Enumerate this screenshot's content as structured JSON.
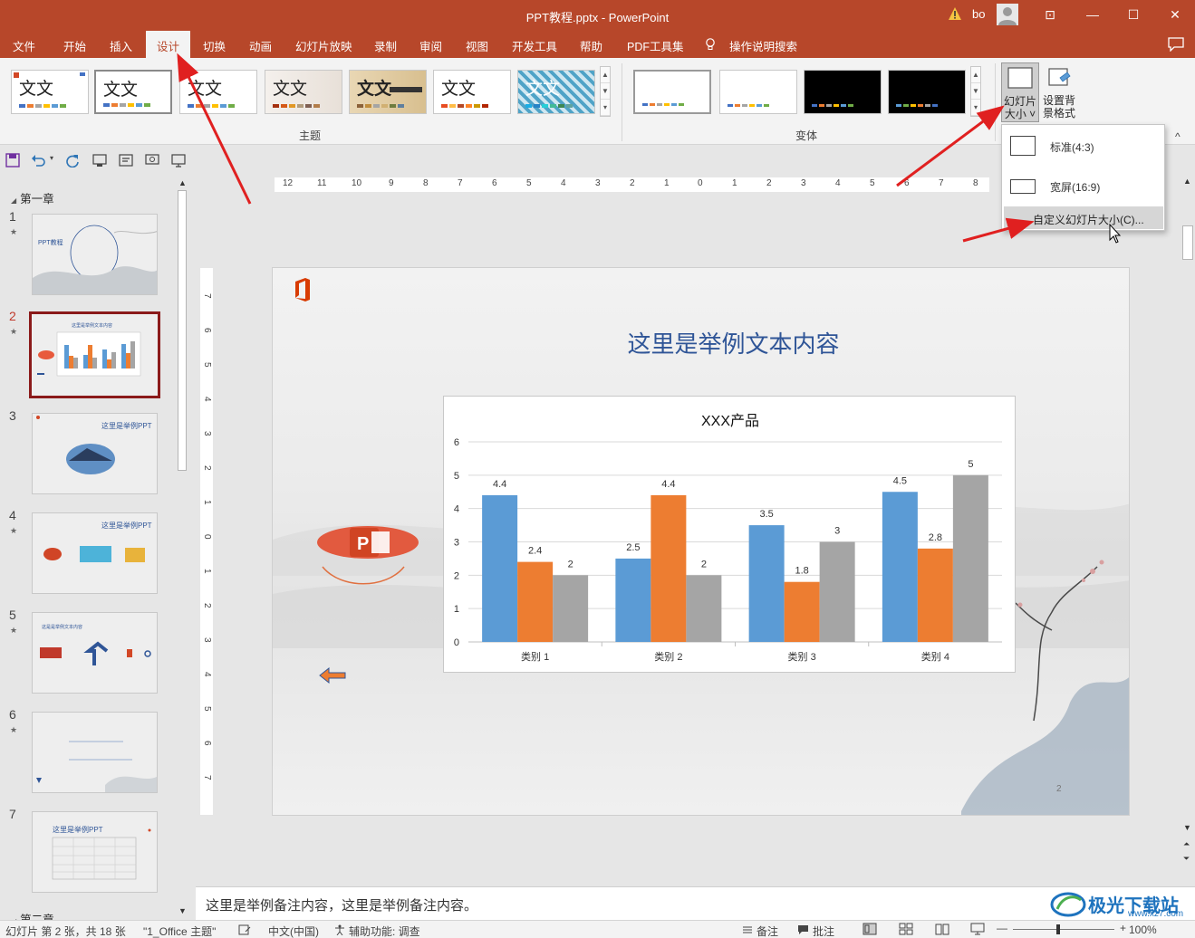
{
  "window": {
    "title": "PPT教程.pptx  -  PowerPoint",
    "user": "bo",
    "controls": {
      "restore_ribbon": "⊡",
      "minimize": "—",
      "maximize": "☐",
      "close": "✕"
    }
  },
  "menu": {
    "tabs": [
      "文件",
      "开始",
      "插入",
      "设计",
      "切换",
      "动画",
      "幻灯片放映",
      "录制",
      "审阅",
      "视图",
      "开发工具",
      "帮助",
      "PDF工具集"
    ],
    "active_tab": "设计",
    "search": "操作说明搜索"
  },
  "ribbon": {
    "themes_label": "主题",
    "theme_sample": "文文",
    "theme_sample_alt": "文文",
    "variants_label": "变体",
    "slide_size_button": [
      "幻灯片",
      "大小 ˅"
    ],
    "bg_format_button": [
      "设置背",
      "景格式"
    ],
    "collapse": "^"
  },
  "slide_size_menu": {
    "items": [
      {
        "label": "标准(4:3)"
      },
      {
        "label": "宽屏(16:9)"
      }
    ],
    "custom": "自定义幻灯片大小(C)..."
  },
  "thumbnails": {
    "section1": "第一章",
    "section2": "第二章",
    "slides": [
      {
        "num": "1",
        "star": "★",
        "text": "PPT教程"
      },
      {
        "num": "2",
        "star": "★",
        "text": "这里是举例文本内容"
      },
      {
        "num": "3",
        "star": "★",
        "text": "这里是举例PPT"
      },
      {
        "num": "4",
        "star": "★",
        "text": "这里是举例PPT"
      },
      {
        "num": "5",
        "star": "★",
        "text": "这是是举例文本内容"
      },
      {
        "num": "6",
        "star": "★",
        "text": ""
      },
      {
        "num": "7",
        "star": "",
        "text": "这里是举例PPT"
      }
    ],
    "current": 2
  },
  "ruler": {
    "horizontal": [
      "12",
      "11",
      "10",
      "9",
      "8",
      "7",
      "6",
      "5",
      "4",
      "3",
      "2",
      "1",
      "0",
      "1",
      "2",
      "3",
      "4",
      "5",
      "6",
      "7",
      "8"
    ],
    "vertical": [
      "7",
      "6",
      "5",
      "4",
      "3",
      "2",
      "1",
      "0",
      "1",
      "2",
      "3",
      "4",
      "5",
      "6",
      "7"
    ]
  },
  "slide": {
    "title": "这里是举例文本内容",
    "page_number": "2"
  },
  "chart_data": {
    "type": "bar",
    "title": "XXX产品",
    "categories": [
      "类别 1",
      "类别 2",
      "类别 3",
      "类别 4"
    ],
    "series": [
      {
        "values": [
          4.4,
          2.5,
          3.5,
          4.5
        ]
      },
      {
        "values": [
          2.4,
          4.4,
          1.8,
          2.8
        ]
      },
      {
        "values": [
          2,
          2,
          3,
          5
        ]
      }
    ],
    "colors": [
      "#5b9bd5",
      "#ed7d31",
      "#a5a5a5"
    ],
    "ylim": [
      0,
      6
    ],
    "yticks": [
      0,
      1,
      2,
      3,
      4,
      5,
      6
    ],
    "grid": true,
    "xlabel": "",
    "ylabel": ""
  },
  "notes": {
    "text": "这里是举例备注内容，这里是举例备注内容。"
  },
  "status": {
    "slide_info": "幻灯片 第 2 张，共 18 张",
    "theme": "\"1_Office 主题\"",
    "language": "中文(中国)",
    "accessibility": "辅助功能: 调查",
    "notes_btn": "备注",
    "comments_btn": "批注",
    "zoom": "100%"
  },
  "watermark": {
    "text": "极光下载站",
    "url": "www.xz7.com"
  },
  "colors": {
    "accent": "#b7472a",
    "title_blue": "#2f5597",
    "arrow_red": "#e02020"
  }
}
